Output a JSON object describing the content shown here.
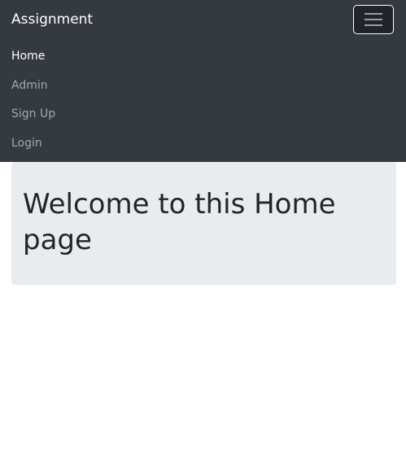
{
  "navbar": {
    "brand": "Assignment",
    "items": [
      {
        "label": "Home",
        "active": true
      },
      {
        "label": "Admin"
      },
      {
        "label": "Sign Up"
      },
      {
        "label": "Login"
      }
    ]
  },
  "jumbotron": {
    "heading": "Welcome to this Home page"
  }
}
